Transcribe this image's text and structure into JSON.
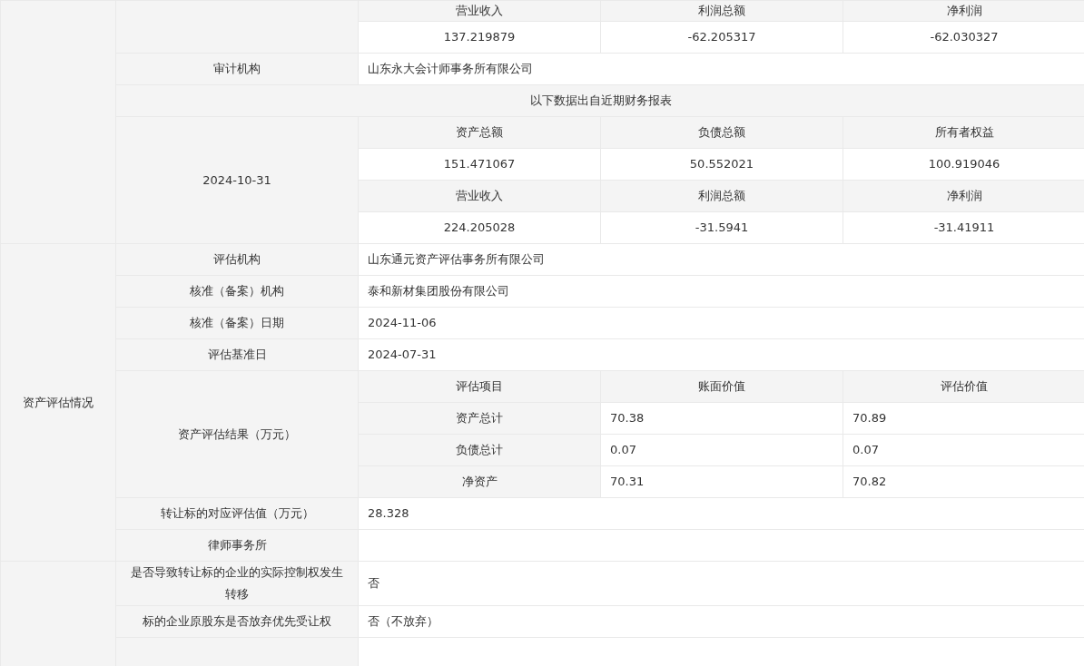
{
  "table": {
    "rows": [
      {
        "cells": [
          {
            "kind": "label",
            "rowspan": 8
          },
          {
            "kind": "label",
            "rowspan": 2
          },
          {
            "kind": "head",
            "text": "营业收入"
          },
          {
            "kind": "head",
            "text": "利润总额"
          },
          {
            "kind": "head",
            "text": "净利润"
          }
        ]
      },
      {
        "cells": [
          {
            "kind": "value",
            "text": "137.219879"
          },
          {
            "kind": "value",
            "text": "-62.205317"
          },
          {
            "kind": "value",
            "text": "-62.030327"
          }
        ]
      },
      {
        "cells": [
          {
            "kind": "label",
            "text": "审计机构"
          },
          {
            "kind": "text",
            "colspan": 3,
            "text": "山东永大会计师事务所有限公司"
          }
        ]
      },
      {
        "cells": [
          {
            "kind": "label",
            "colspan": 4,
            "text": "以下数据出自近期财务报表"
          }
        ]
      },
      {
        "cells": [
          {
            "kind": "label",
            "rowspan": 4,
            "text": "2024-10-31"
          },
          {
            "kind": "head",
            "text": "资产总额"
          },
          {
            "kind": "head",
            "text": "负债总额"
          },
          {
            "kind": "head",
            "text": "所有者权益"
          }
        ]
      },
      {
        "cells": [
          {
            "kind": "value",
            "text": "151.471067"
          },
          {
            "kind": "value",
            "text": "50.552021"
          },
          {
            "kind": "value",
            "text": "100.919046"
          }
        ]
      },
      {
        "cells": [
          {
            "kind": "head",
            "text": "营业收入"
          },
          {
            "kind": "head",
            "text": "利润总额"
          },
          {
            "kind": "head",
            "text": "净利润"
          }
        ]
      },
      {
        "cells": [
          {
            "kind": "value",
            "text": "224.205028"
          },
          {
            "kind": "value",
            "text": "-31.5941"
          },
          {
            "kind": "value",
            "text": "-31.41911"
          }
        ]
      },
      {
        "cells": [
          {
            "kind": "label",
            "rowspan": 10,
            "text": "资产评估情况"
          },
          {
            "kind": "label",
            "text": "评估机构"
          },
          {
            "kind": "text",
            "colspan": 3,
            "text": "山东通元资产评估事务所有限公司"
          }
        ]
      },
      {
        "cells": [
          {
            "kind": "label",
            "text": "核准（备案）机构"
          },
          {
            "kind": "text",
            "colspan": 3,
            "text": "泰和新材集团股份有限公司"
          }
        ]
      },
      {
        "cells": [
          {
            "kind": "label",
            "text": "核准（备案）日期"
          },
          {
            "kind": "text",
            "colspan": 3,
            "text": "2024-11-06"
          }
        ]
      },
      {
        "cells": [
          {
            "kind": "label",
            "text": "评估基准日"
          },
          {
            "kind": "text",
            "colspan": 3,
            "text": "2024-07-31"
          }
        ]
      },
      {
        "cells": [
          {
            "kind": "label",
            "rowspan": 4,
            "text": "资产评估结果（万元）"
          },
          {
            "kind": "head",
            "text": "评估项目"
          },
          {
            "kind": "head",
            "text": "账面价值"
          },
          {
            "kind": "head",
            "text": "评估价值"
          }
        ]
      },
      {
        "cells": [
          {
            "kind": "head",
            "text": "资产总计"
          },
          {
            "kind": "text",
            "text": "70.38"
          },
          {
            "kind": "text",
            "text": "70.89"
          }
        ]
      },
      {
        "cells": [
          {
            "kind": "head",
            "text": "负债总计"
          },
          {
            "kind": "text",
            "text": "0.07"
          },
          {
            "kind": "text",
            "text": "0.07"
          }
        ]
      },
      {
        "cells": [
          {
            "kind": "head",
            "text": "净资产"
          },
          {
            "kind": "text",
            "text": "70.31"
          },
          {
            "kind": "text",
            "text": "70.82"
          }
        ]
      },
      {
        "cells": [
          {
            "kind": "label",
            "text": "转让标的对应评估值（万元）"
          },
          {
            "kind": "text",
            "colspan": 3,
            "text": "28.328"
          }
        ]
      },
      {
        "cells": [
          {
            "kind": "label",
            "text": "律师事务所"
          },
          {
            "kind": "text",
            "colspan": 3
          }
        ]
      },
      {
        "cells": [
          {
            "kind": "label",
            "rowspan": 3
          },
          {
            "kind": "label",
            "text": "是否导致转让标的企业的实际控制权发生转移"
          },
          {
            "kind": "text",
            "colspan": 3,
            "text": "否"
          }
        ]
      },
      {
        "cells": [
          {
            "kind": "label",
            "text": "标的企业原股东是否放弃优先受让权"
          },
          {
            "kind": "text",
            "colspan": 3,
            "text": "否（不放弃）"
          }
        ]
      },
      {
        "cells": [
          {
            "kind": "label"
          },
          {
            "kind": "text",
            "colspan": 3
          }
        ]
      }
    ]
  }
}
